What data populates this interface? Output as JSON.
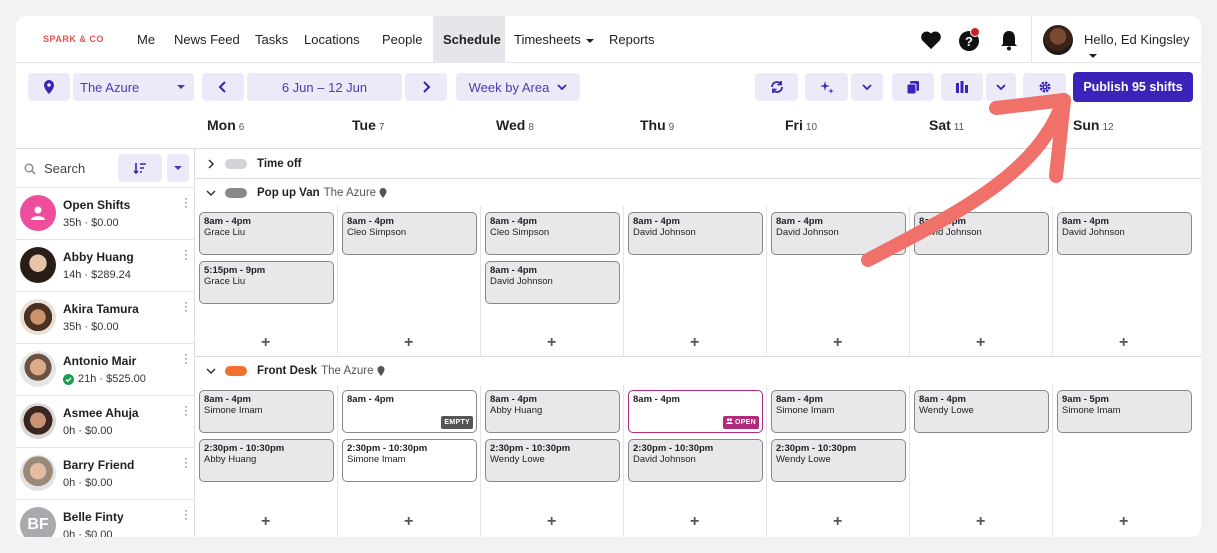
{
  "nav": {
    "brand": "SPARK & CO",
    "items": [
      "Me",
      "News Feed",
      "Tasks",
      "Locations",
      "People",
      "Schedule",
      "Timesheets",
      "Reports"
    ],
    "user": "Hello, Ed Kingsley"
  },
  "toolbar": {
    "location": "The Azure",
    "date_range": "6 Jun – 12 Jun",
    "view": "Week by Area",
    "publish": "Publish 95 shifts"
  },
  "days": [
    {
      "name": "Mon",
      "num": "6"
    },
    {
      "name": "Tue",
      "num": "7"
    },
    {
      "name": "Wed",
      "num": "8"
    },
    {
      "name": "Thu",
      "num": "9"
    },
    {
      "name": "Fri",
      "num": "10"
    },
    {
      "name": "Sat",
      "num": "11"
    },
    {
      "name": "Sun",
      "num": "12"
    }
  ],
  "sidebar": {
    "search_placeholder": "Search",
    "people": [
      {
        "name": "Open Shifts",
        "meta": "35h · $0.00",
        "color": "#ee4d9b"
      },
      {
        "name": "Abby Huang",
        "meta": "14h · $289.24",
        "color": "#3b2a22"
      },
      {
        "name": "Akira Tamura",
        "meta": "35h · $0.00",
        "color": "#5a3a24"
      },
      {
        "name": "Antonio Mair",
        "meta": "21h · $525.00",
        "color": "#b58a6a"
      },
      {
        "name": "Asmee Ahuja",
        "meta": "0h · $0.00",
        "color": "#4a2f25"
      },
      {
        "name": "Barry Friend",
        "meta": "0h · $0.00",
        "color": "#9a8878"
      },
      {
        "name": "Belle Finty",
        "meta": "0h · $0.00",
        "color": "#a9a9ae",
        "initials": "BF"
      }
    ]
  },
  "groups": [
    {
      "label": "Time off",
      "location": ""
    },
    {
      "label": "Pop up Van",
      "location": "The Azure"
    },
    {
      "label": "Front Desk",
      "location": "The Azure"
    }
  ],
  "shifts_popup": [
    [
      {
        "time": "8am - 4pm",
        "who": "Grace Liu"
      },
      {
        "time": "5:15pm - 9pm",
        "who": "Grace Liu"
      }
    ],
    [
      {
        "time": "8am - 4pm",
        "who": "Cleo Simpson"
      }
    ],
    [
      {
        "time": "8am - 4pm",
        "who": "Cleo Simpson"
      },
      {
        "time": "8am - 4pm",
        "who": "David Johnson"
      }
    ],
    [
      {
        "time": "8am - 4pm",
        "who": "David Johnson"
      }
    ],
    [
      {
        "time": "8am - 4pm",
        "who": "David Johnson"
      }
    ],
    [
      {
        "time": "8am - 4pm",
        "who": "David Johnson"
      }
    ],
    [
      {
        "time": "8am - 4pm",
        "who": "David Johnson"
      }
    ]
  ],
  "shifts_front": [
    [
      {
        "time": "8am - 4pm",
        "who": "Simone Imam"
      },
      {
        "time": "2:30pm - 10:30pm",
        "who": "Abby Huang"
      }
    ],
    [
      {
        "time": "8am - 4pm",
        "who": "",
        "badge": "EMPTY"
      },
      {
        "time": "2:30pm - 10:30pm",
        "who": "Simone Imam"
      }
    ],
    [
      {
        "time": "8am - 4pm",
        "who": "Abby Huang"
      },
      {
        "time": "2:30pm - 10:30pm",
        "who": "Wendy Lowe"
      }
    ],
    [
      {
        "time": "8am - 4pm",
        "who": "",
        "badge": "OPEN"
      },
      {
        "time": "2:30pm - 10:30pm",
        "who": "David Johnson"
      }
    ],
    [
      {
        "time": "8am - 4pm",
        "who": "Simone Imam"
      },
      {
        "time": "2:30pm - 10:30pm",
        "who": "Wendy Lowe"
      }
    ],
    [
      {
        "time": "8am - 4pm",
        "who": "Wendy Lowe"
      }
    ],
    [
      {
        "time": "9am - 5pm",
        "who": "Simone Imam"
      }
    ]
  ],
  "colors": {
    "accent": "#3a23b8",
    "arrow": "#f0706a",
    "popup": "#888888",
    "front": "#f07030",
    "open": "#b22a7d"
  }
}
